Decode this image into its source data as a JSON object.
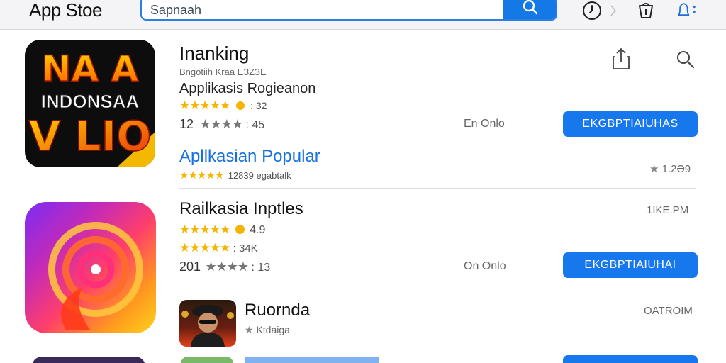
{
  "window": {
    "app_title": "App Stoe"
  },
  "search": {
    "placeholder": "Sapnaah"
  },
  "icons": {
    "search": "search-icon",
    "history": "clock-icon",
    "bag": "shopping-bag-icon",
    "notifications": "bell-icon",
    "share": "share-icon",
    "search_small": "search-icon"
  },
  "featured": {
    "name": "Inanking",
    "developer": "Bngotiih Kraa EЗZЗE",
    "category": "Applikasis Rogieanon",
    "rating_stars": "★★★★★",
    "rating_value": ": 32",
    "review_count_prefix": "12",
    "review_stars": "★★★★",
    "review_value": ": 45",
    "status": "En Onlo",
    "action_label": "EKGBPTIAIUHAS",
    "icon_text_lines": [
      "NA A",
      "INDONSAA",
      "V LIO"
    ]
  },
  "section": {
    "title": "Apllkasian Popular",
    "stars": "★★★★★",
    "count_text": "12839 egabtalk",
    "right_value": "1.2Ә9"
  },
  "app2": {
    "name": "Railkasia Inptles",
    "right_meta": "1IKE.PM",
    "rating_stars": "★★★★★",
    "rating_value": "4.9",
    "rating2_stars": "★★★★★",
    "rating2_value": ": 34K",
    "review_count_prefix": "201",
    "review_stars": "★★★★",
    "review_value": ": 13",
    "status": "On Onlo",
    "action_label": "EKGBPTIAIUHAI"
  },
  "app3": {
    "name": "Ruornda",
    "sub": "Ktdaiga",
    "right_meta": "OATROIM"
  },
  "colors": {
    "accent": "#1778ee",
    "star": "#f5b400",
    "link": "#1572e0"
  }
}
